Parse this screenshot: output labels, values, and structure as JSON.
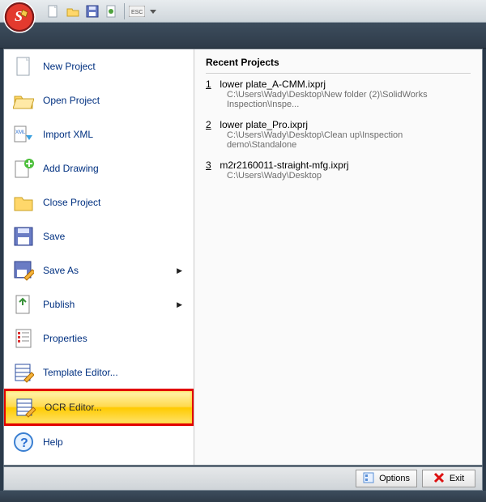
{
  "qat": {
    "items": [
      "new-icon",
      "open-icon",
      "save-icon",
      "publish-icon",
      "esc-icon"
    ]
  },
  "menu": {
    "items": [
      {
        "label": "New Project",
        "icon": "new-project-icon",
        "arrow": false
      },
      {
        "label": "Open Project",
        "icon": "open-folder-icon",
        "arrow": false
      },
      {
        "label": "Import XML",
        "icon": "import-xml-icon",
        "arrow": false
      },
      {
        "label": "Add Drawing",
        "icon": "add-drawing-icon",
        "arrow": false
      },
      {
        "label": "Close Project",
        "icon": "close-folder-icon",
        "arrow": false
      },
      {
        "label": "Save",
        "icon": "save-icon",
        "arrow": false
      },
      {
        "label": "Save As",
        "icon": "save-as-icon",
        "arrow": true
      },
      {
        "label": "Publish",
        "icon": "publish-icon",
        "arrow": true
      },
      {
        "label": "Properties",
        "icon": "properties-icon",
        "arrow": false
      },
      {
        "label": "Template Editor...",
        "icon": "template-icon",
        "arrow": false
      },
      {
        "label": "OCR Editor...",
        "icon": "ocr-icon",
        "arrow": false,
        "highlighted": true
      },
      {
        "label": "Help",
        "icon": "help-icon",
        "arrow": false
      }
    ]
  },
  "recent": {
    "title": "Recent Projects",
    "items": [
      {
        "num": "1",
        "name": "lower plate_A-CMM.ixprj",
        "path": "C:\\Users\\Wady\\Desktop\\New folder (2)\\SolidWorks Inspection\\Inspe..."
      },
      {
        "num": "2",
        "name": "lower plate_Pro.ixprj",
        "path": "C:\\Users\\Wady\\Desktop\\Clean up\\Inspection demo\\Standalone"
      },
      {
        "num": "3",
        "name": "m2r2160011-straight-mfg.ixprj",
        "path": "C:\\Users\\Wady\\Desktop"
      }
    ]
  },
  "footer": {
    "options_label": "Options",
    "exit_label": "Exit"
  }
}
